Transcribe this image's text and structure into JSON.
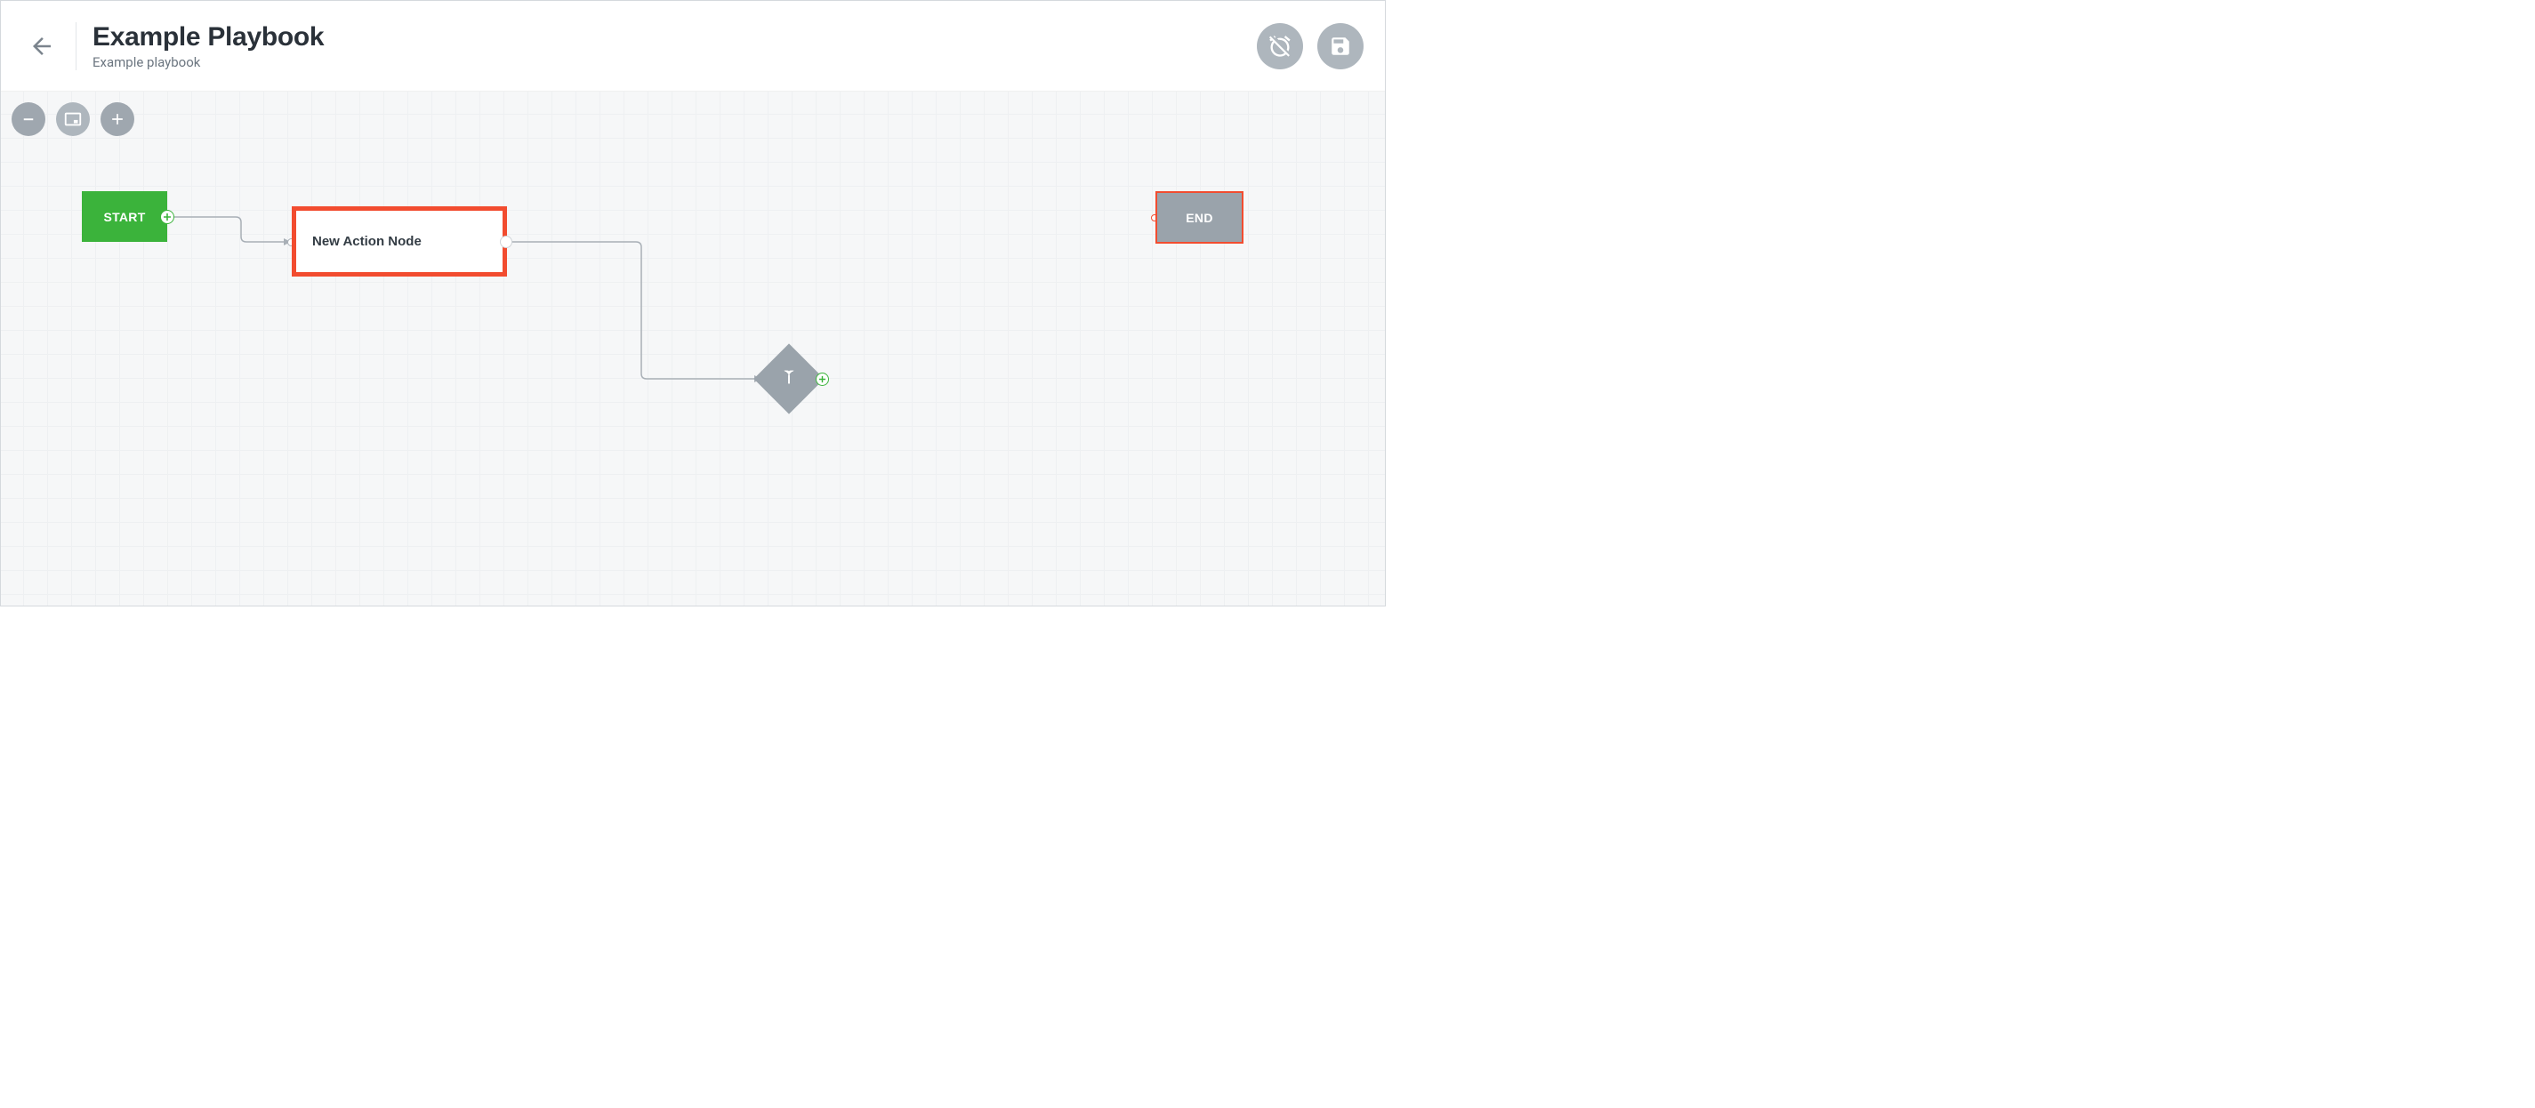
{
  "header": {
    "title": "Example Playbook",
    "subtitle": "Example playbook",
    "icons": {
      "back": "arrow-left-icon",
      "schedule_off": "alarm-off-icon",
      "save": "save-icon"
    }
  },
  "toolbar": {
    "zoom_out": "minus-icon",
    "fit": "fit-screen-icon",
    "zoom_in": "plus-icon"
  },
  "nodes": {
    "start": {
      "label": "START"
    },
    "action": {
      "label": "New Action Node"
    },
    "decision": {
      "icon": "branch-icon"
    },
    "end": {
      "label": "END"
    }
  },
  "colors": {
    "accent_orange": "#f24c2f",
    "green": "#3bb33b",
    "gray_node": "#9aa3ab",
    "gray_btn": "#aeb6bd"
  }
}
